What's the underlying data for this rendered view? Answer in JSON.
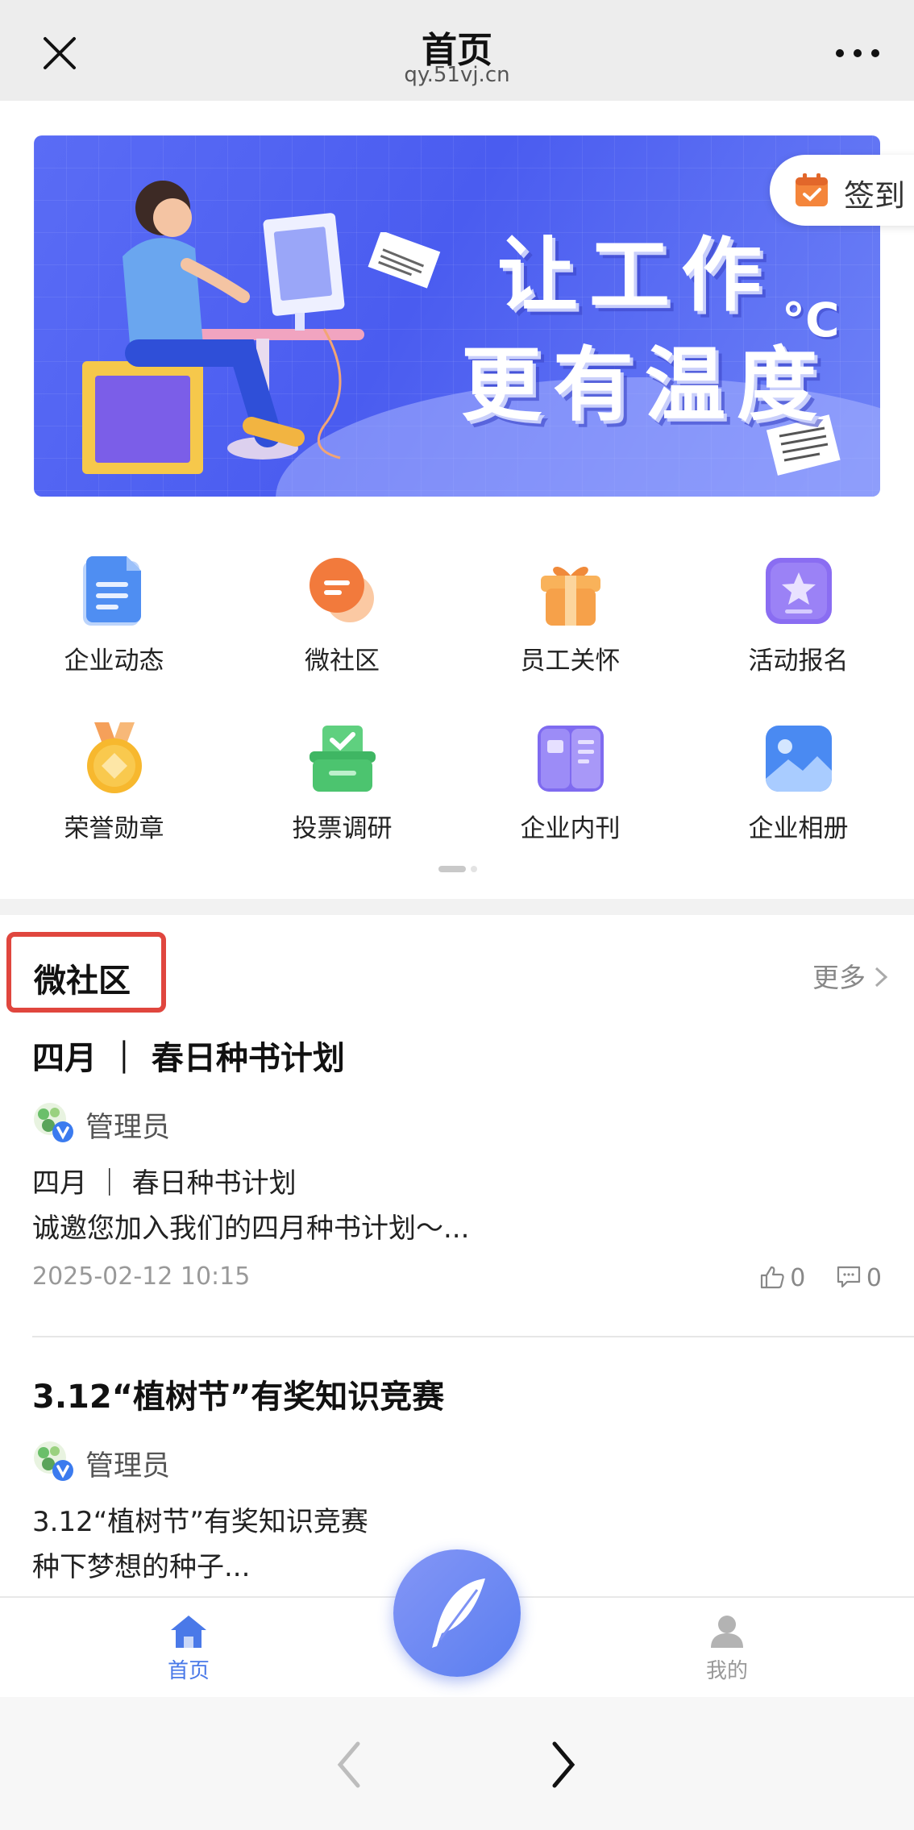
{
  "nav": {
    "title": "首页",
    "domain": "qy.51vj.cn"
  },
  "banner": {
    "line1": "让工作",
    "line2": "更有温度",
    "degree": "°C"
  },
  "signin": {
    "label": "签到"
  },
  "menu": [
    {
      "label": "企业动态",
      "icon": "document-icon"
    },
    {
      "label": "微社区",
      "icon": "chat-bubble-icon"
    },
    {
      "label": "员工关怀",
      "icon": "gift-icon"
    },
    {
      "label": "活动报名",
      "icon": "star-badge-icon"
    },
    {
      "label": "荣誉勋章",
      "icon": "medal-icon"
    },
    {
      "label": "投票调研",
      "icon": "ballot-box-icon"
    },
    {
      "label": "企业内刊",
      "icon": "magazine-icon"
    },
    {
      "label": "企业相册",
      "icon": "photo-album-icon"
    }
  ],
  "section": {
    "title": "微社区",
    "more": "更多"
  },
  "posts": [
    {
      "title": "四月 ｜ 春日种书计划",
      "author": "管理员",
      "body_line1": "四月 ｜ 春日种书计划",
      "body_line2": "诚邀您加入我们的四月种书计划～...",
      "time": "2025-02-12 10:15",
      "likes": "0",
      "comments": "0"
    },
    {
      "title": "3.12“植树节”有奖知识竞赛",
      "author": "管理员",
      "body_line1": "3.12“植树节”有奖知识竞赛",
      "body_line2": "种下梦想的种子..."
    }
  ],
  "tabbar": {
    "home": "首页",
    "mine": "我的"
  },
  "colors": {
    "accent": "#4a79e8",
    "highlight_border": "#e0463e"
  }
}
